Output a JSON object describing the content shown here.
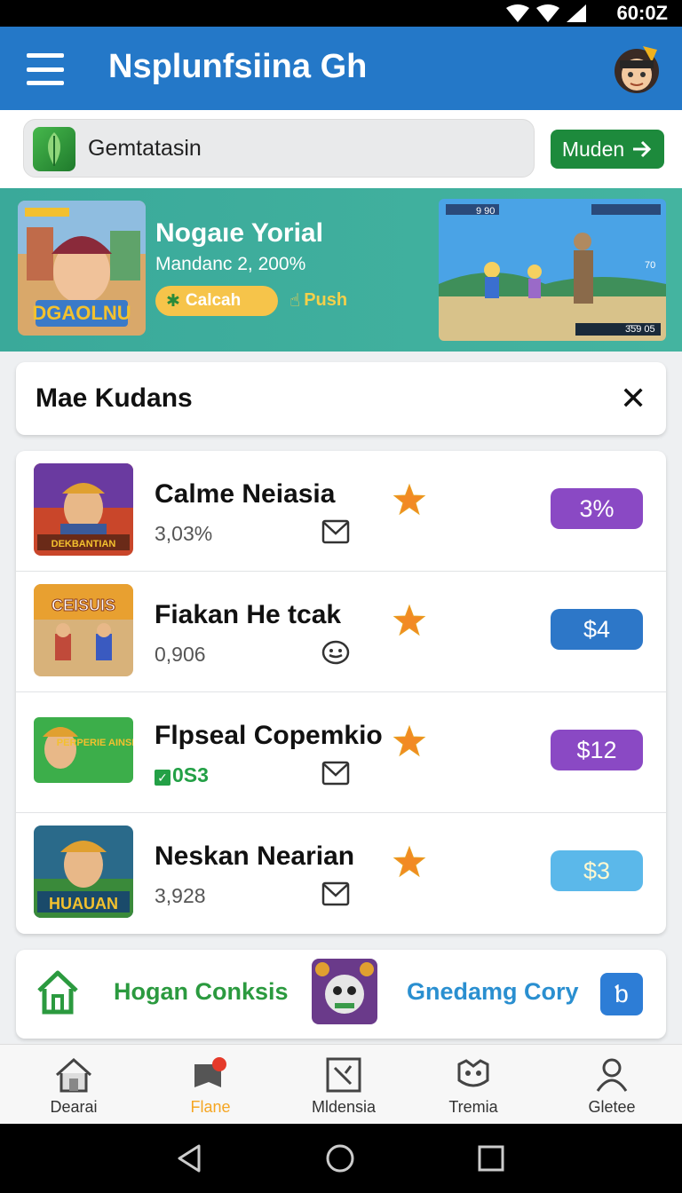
{
  "status_bar": {
    "time": "60:0Z"
  },
  "app_bar": {
    "title": "Nsplunfsiina Gh"
  },
  "search": {
    "value": "Gemtatasin",
    "button_label": "Muden"
  },
  "banner": {
    "title": "Nogaıe Yorial",
    "subtitle": "Mandanc 2, 200%",
    "chip_label": "Calcah",
    "push_label": "Push",
    "art_left_caption": "DGAOLNU",
    "art_right_hud_top": "9 90",
    "art_right_hud_mid": "70",
    "art_right_hud_bottom": "3̄5̄9 05"
  },
  "section": {
    "title": "Mae Kudans"
  },
  "games": [
    {
      "name": "Calme Neiasia",
      "meta": "3,03%",
      "meta_style": "normal",
      "icon": "mail-icon",
      "price": "3%",
      "price_color": "#8a49c4",
      "thumb_caption": "DEKBANTIAN"
    },
    {
      "name": "Fiakan He tcak",
      "meta": "0,906",
      "meta_style": "normal",
      "icon": "face-icon",
      "price": "$4",
      "price_color": "#2d77c8",
      "thumb_caption": "CEISUIS"
    },
    {
      "name": "Flpseal Copemkio",
      "meta": "0S3",
      "meta_style": "green",
      "icon": "mail-icon",
      "price": "$12",
      "price_color": "#8a49c4",
      "thumb_caption": "PERPERIE AINSNU"
    },
    {
      "name": "Neskan Nearian",
      "meta": "3,928",
      "meta_style": "normal",
      "icon": "mail-icon",
      "price": "$3",
      "price_color": "#5bb8ea",
      "thumb_caption": "HUAUAN"
    }
  ],
  "promo": {
    "left_label": "Hogan Conksis",
    "right_label": "Gnedamg Cory",
    "button_glyph": "ƅ"
  },
  "bottom_nav": [
    {
      "label": "Dearai",
      "icon": "home-icon",
      "active": false
    },
    {
      "label": "Flane",
      "icon": "flag-icon",
      "active": true
    },
    {
      "label": "Mldensia",
      "icon": "chart-icon",
      "active": false
    },
    {
      "label": "Tremia",
      "icon": "controller-icon",
      "active": false
    },
    {
      "label": "Gletee",
      "icon": "profile-icon",
      "active": false
    }
  ],
  "colors": {
    "primary": "#2478c8",
    "banner": "#3aa99a",
    "accent_green": "#1d8a3c",
    "active_nav": "#f5a623"
  }
}
